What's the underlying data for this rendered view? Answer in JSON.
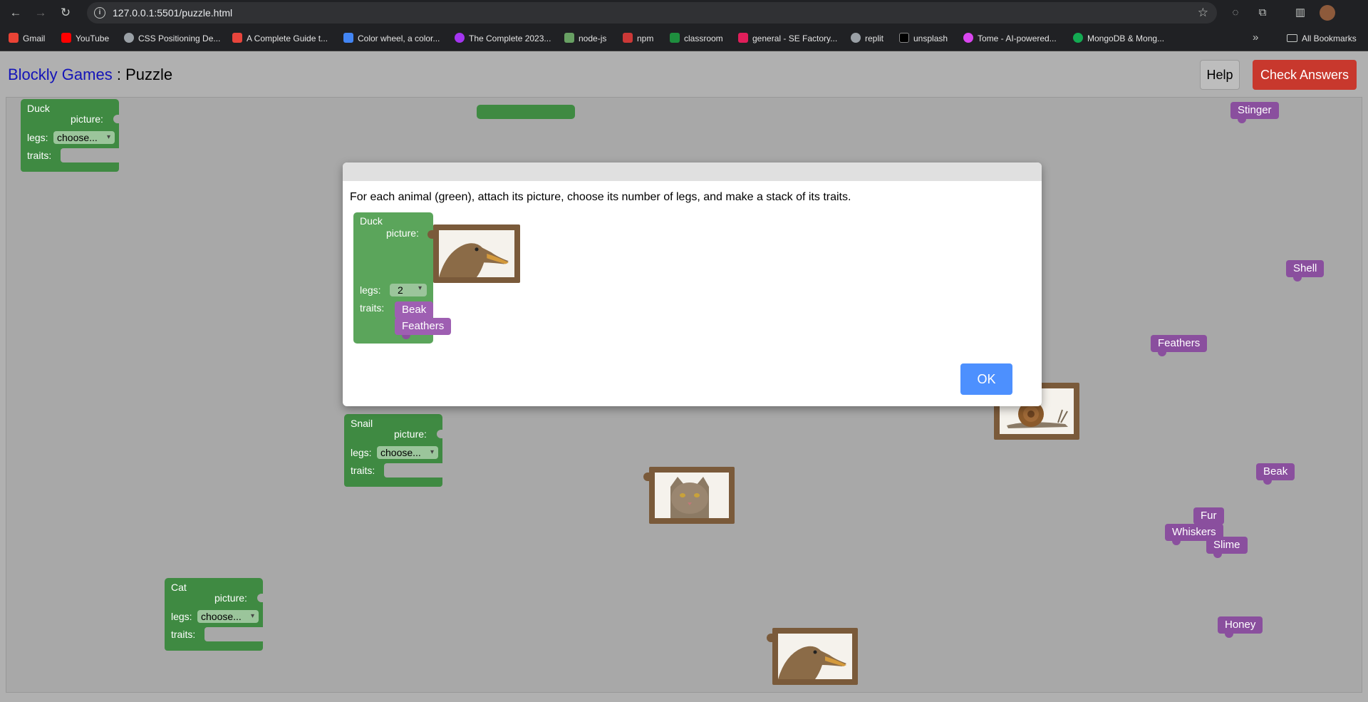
{
  "browser": {
    "url": "127.0.0.1:5501/puzzle.html",
    "bookmarks": [
      {
        "label": "Gmail",
        "icon": "gmail-icon",
        "color": "#ea4335"
      },
      {
        "label": "YouTube",
        "icon": "youtube-icon",
        "color": "#ff0000"
      },
      {
        "label": "CSS Positioning De...",
        "icon": "globe-icon",
        "color": "#9aa0a6"
      },
      {
        "label": "A Complete Guide t...",
        "icon": "asterisk-icon",
        "color": "#e8453c"
      },
      {
        "label": "Color wheel, a color...",
        "icon": "colorwheel-icon",
        "color": "#4285f4"
      },
      {
        "label": "The Complete 2023...",
        "icon": "udemy-icon",
        "color": "#a435f0"
      },
      {
        "label": "node-js",
        "icon": "node-icon",
        "color": "#68a063"
      },
      {
        "label": "npm",
        "icon": "npm-icon",
        "color": "#cb3837"
      },
      {
        "label": "classroom",
        "icon": "classroom-icon",
        "color": "#1e8e3e"
      },
      {
        "label": "general - SE Factory...",
        "icon": "slack-icon",
        "color": "#e01e5a"
      },
      {
        "label": "replit",
        "icon": "globe-icon",
        "color": "#9aa0a6"
      },
      {
        "label": "unsplash",
        "icon": "unsplash-icon",
        "color": "#000000"
      },
      {
        "label": "Tome - AI-powered...",
        "icon": "tome-icon",
        "color": "#d946ef"
      },
      {
        "label": "MongoDB & Mong...",
        "icon": "mongodb-icon",
        "color": "#13aa52"
      }
    ],
    "all_bookmarks": "All Bookmarks"
  },
  "header": {
    "brand": "Blockly Games",
    "separator": " : ",
    "title": "Puzzle",
    "help": "Help",
    "check": "Check Answers"
  },
  "workspace": {
    "animals": [
      {
        "name": "Duck",
        "picture_label": "picture:",
        "legs_label": "legs:",
        "legs_value": "choose...",
        "traits_label": "traits:"
      },
      {
        "name": "Snail",
        "picture_label": "picture:",
        "legs_label": "legs:",
        "legs_value": "choose...",
        "traits_label": "traits:"
      },
      {
        "name": "Cat",
        "picture_label": "picture:",
        "legs_label": "legs:",
        "legs_value": "choose...",
        "traits_label": "traits:"
      }
    ],
    "traits": [
      "Stinger",
      "Shell",
      "Feathers",
      "Beak",
      "Fur",
      "Whiskers",
      "Slime",
      "Honey"
    ],
    "pictures": [
      "snail",
      "cat",
      "duck"
    ]
  },
  "dialog": {
    "text": "For each animal (green), attach its picture, choose its number of legs, and make a stack of its traits.",
    "example": {
      "name": "Duck",
      "picture_label": "picture:",
      "legs_label": "legs:",
      "legs_value": "2",
      "traits_label": "traits:",
      "traits": [
        "Beak",
        "Feathers"
      ]
    },
    "ok": "OK"
  }
}
